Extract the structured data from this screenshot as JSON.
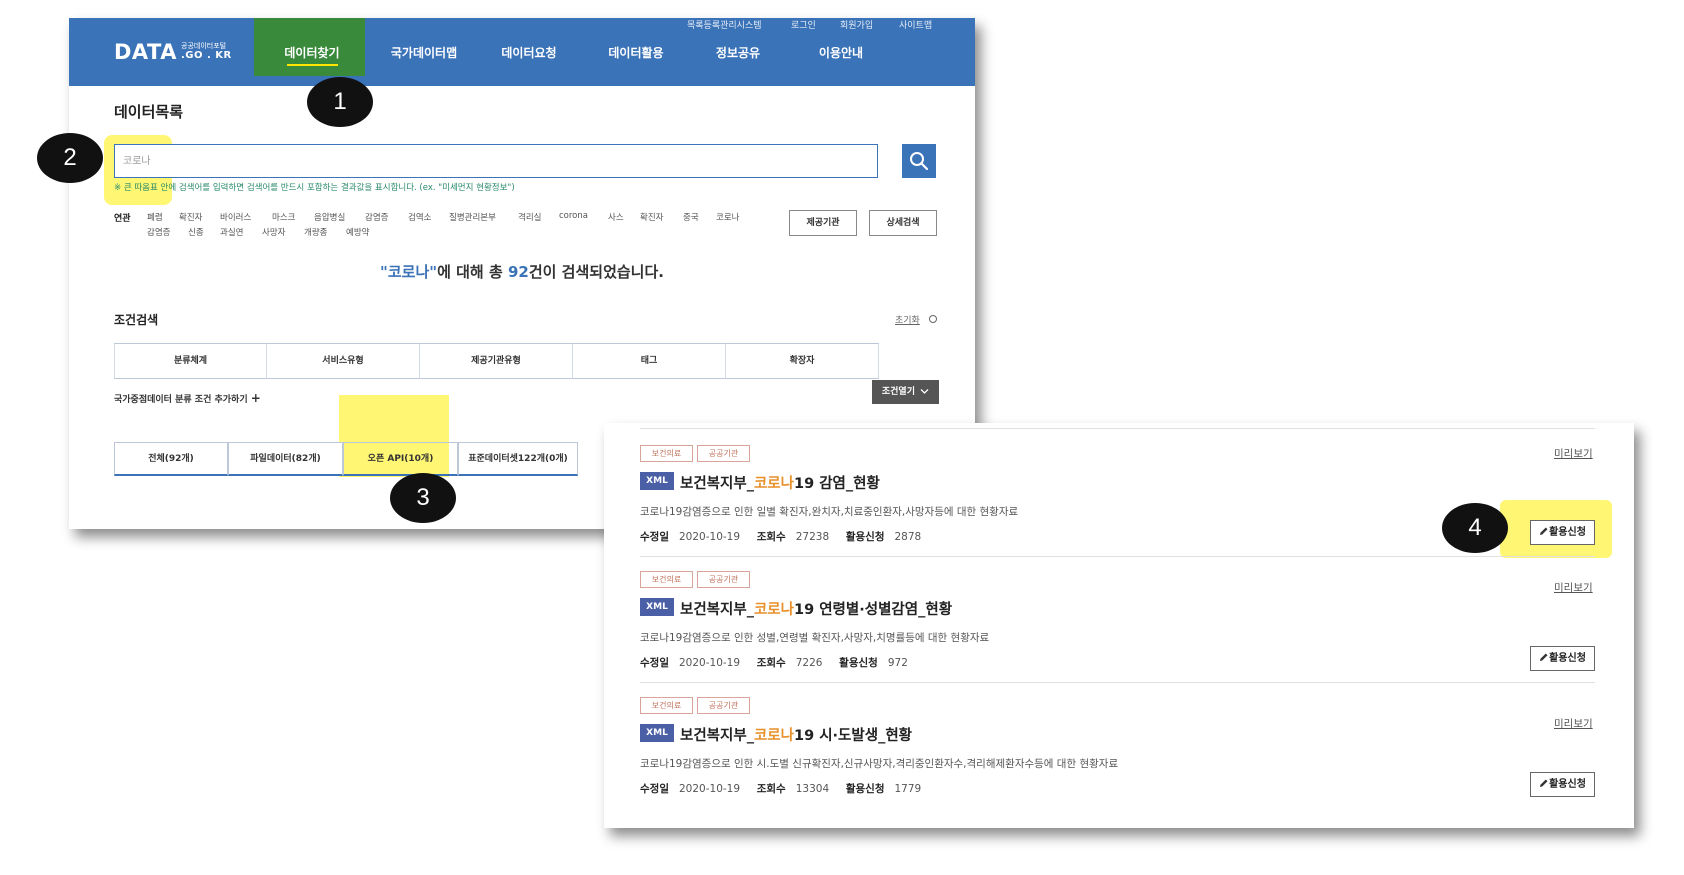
{
  "brand": {
    "logo": "DATA",
    "logo_small_1": "공공데이터포털",
    "logo_small_2": ".GO . KR"
  },
  "util_links": [
    "목록등록관리시스템",
    "로그인",
    "회원가입",
    "사이트맵"
  ],
  "menu": [
    "데이터찾기",
    "국가데이터맵",
    "데이터요청",
    "데이터활용",
    "정보공유",
    "이용안내"
  ],
  "page_title": "데이터목록",
  "search": {
    "value": "코로나",
    "hint": "※ 큰 따옴표 안에 검색어를 입력하면 검색어를 반드시 포함하는 결과값을 표시합니다. (ex. \"미세먼지 현황정보\")"
  },
  "related": {
    "label": "연관",
    "row1": [
      "폐렴",
      "확진자",
      "바이러스",
      "마스크",
      "음압병실",
      "감염증",
      "검역소",
      "질병관리본부",
      "격리실",
      "corona",
      "사스",
      "확진자",
      "중국",
      "코로나"
    ],
    "row2": [
      "감염증",
      "신종",
      "과실연",
      "사망자",
      "개량종",
      "예방약"
    ]
  },
  "buttons": {
    "provider": "제공기관",
    "detail_search": "상세검색"
  },
  "result_summary": {
    "prefix": "\"",
    "query": "코로나",
    "mid": "\"에 대해 총 ",
    "count": "92",
    "suffix": "건이 검색되었습니다."
  },
  "conditions": {
    "title": "조건검색",
    "reset": "초기화",
    "columns": [
      "분류체계",
      "서비스유형",
      "제공기관유형",
      "태그",
      "확장자"
    ],
    "add_label": "국가중점데이터 분류 조건 추가하기",
    "add_icon": "+",
    "open_label": "조건열기",
    "open_icon": "chevron-down"
  },
  "tabs": [
    "전체(92개)",
    "파일데이터(82개)",
    "오픈 API(10개)",
    "표준데이터셋122개(0개)"
  ],
  "results": [
    {
      "badges": [
        "보건의료",
        "공공기관"
      ],
      "format": "XML",
      "title_prefix": "보건복지부_",
      "title_keyword": "코로나",
      "title_suffix": "19 감염_현황",
      "description": "코로나19감염증으로 인한 일별 확진자,완치자,치료중인환자,사망자등에 대한 현황자료",
      "modified_label": "수정일",
      "modified": "2020-10-19",
      "views_label": "조회수",
      "views": "27238",
      "apply_count_label": "활용신청",
      "apply_count": "2878",
      "preview": "미리보기",
      "apply_button": "활용신청"
    },
    {
      "badges": [
        "보건의료",
        "공공기관"
      ],
      "format": "XML",
      "title_prefix": "보건복지부_",
      "title_keyword": "코로나",
      "title_suffix": "19 연령별·성별감염_현황",
      "description": "코로나19감염증으로 인한 성별,연령별 확진자,사망자,치명률등에 대한 현황자료",
      "modified_label": "수정일",
      "modified": "2020-10-19",
      "views_label": "조회수",
      "views": "7226",
      "apply_count_label": "활용신청",
      "apply_count": "972",
      "preview": "미리보기",
      "apply_button": "활용신청"
    },
    {
      "badges": [
        "보건의료",
        "공공기관"
      ],
      "format": "XML",
      "title_prefix": "보건복지부_",
      "title_keyword": "코로나",
      "title_suffix": "19 시·도발생_현황",
      "description": "코로나19감염증으로 인한 시.도별 신규확진자,신규사망자,격리중인환자수,격리해제환자수등에 대한 현황자료",
      "modified_label": "수정일",
      "modified": "2020-10-19",
      "views_label": "조회수",
      "views": "13304",
      "apply_count_label": "활용신청",
      "apply_count": "1779",
      "preview": "미리보기",
      "apply_button": "활용신청"
    }
  ],
  "steps": [
    "1",
    "2",
    "3",
    "4"
  ],
  "colors": {
    "nav": "#3b73b8",
    "active_menu": "#3a8a3c",
    "highlight": "#fff000",
    "xml_tag": "#4a5fa6",
    "keyword": "#e8902a"
  }
}
